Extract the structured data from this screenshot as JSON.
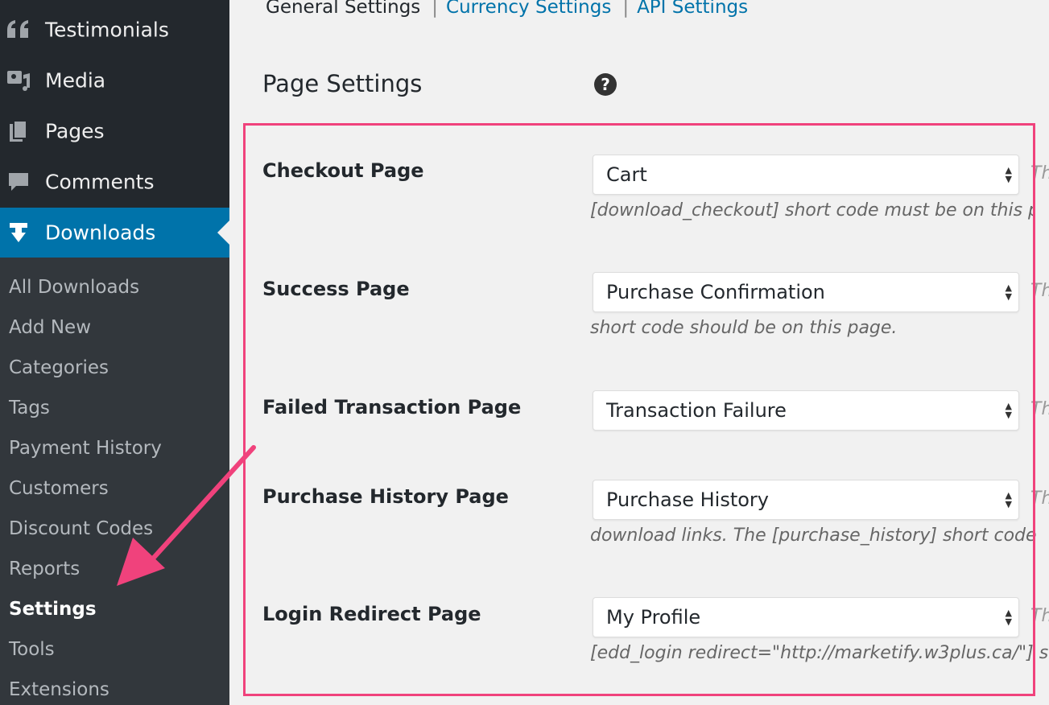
{
  "sidebar": {
    "top_items": [
      {
        "label": "Testimonials",
        "icon": "quote-icon"
      },
      {
        "label": "Media",
        "icon": "media-icon"
      },
      {
        "label": "Pages",
        "icon": "pages-icon"
      },
      {
        "label": "Comments",
        "icon": "comments-icon"
      },
      {
        "label": "Downloads",
        "icon": "download-icon"
      }
    ],
    "submenu": [
      {
        "label": "All Downloads"
      },
      {
        "label": "Add New"
      },
      {
        "label": "Categories"
      },
      {
        "label": "Tags"
      },
      {
        "label": "Payment History"
      },
      {
        "label": "Customers"
      },
      {
        "label": "Discount Codes"
      },
      {
        "label": "Reports"
      },
      {
        "label": "Settings"
      },
      {
        "label": "Tools"
      },
      {
        "label": "Extensions"
      }
    ]
  },
  "tabs": [
    {
      "label": "General Settings"
    },
    {
      "label": "Currency Settings"
    },
    {
      "label": "API Settings"
    }
  ],
  "section": {
    "title": "Page Settings",
    "help_icon": "?"
  },
  "rows": [
    {
      "label": "Checkout Page",
      "value": "Cart",
      "desc": "[download_checkout] short code must be on this p",
      "desc_right": "Th"
    },
    {
      "label": "Success Page",
      "value": "Purchase Confirmation",
      "desc": "short code should be on this page.",
      "desc_right": "Th"
    },
    {
      "label": "Failed Transaction Page",
      "value": "Transaction Failure",
      "desc": "",
      "desc_right": "Th"
    },
    {
      "label": "Purchase History Page",
      "value": "Purchase History",
      "desc": "download links. The [purchase_history] short code",
      "desc_right": "Th"
    },
    {
      "label": "Login Redirect Page",
      "value": "My Profile",
      "desc": "[edd_login redirect=\"http://marketify.w3plus.ca/\"] s",
      "desc_right": "Th"
    }
  ],
  "colors": {
    "sidebar_bg": "#23282d",
    "submenu_bg": "#32373c",
    "active_bg": "#0073aa",
    "link": "#0073aa",
    "highlight": "#f0427c"
  }
}
